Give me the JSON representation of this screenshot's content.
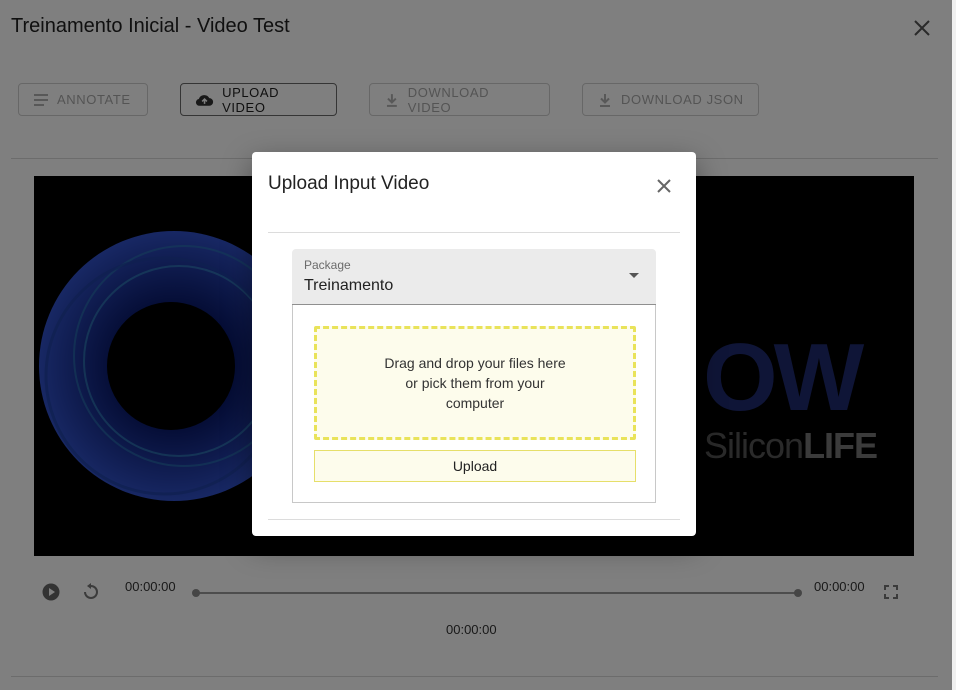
{
  "app": {
    "title": "Treinamento Inicial - Video Test"
  },
  "toolbar": {
    "annotate_label": "ANNOTATE",
    "upload_video_label": "UPLOAD VIDEO",
    "download_video_label": "DOWNLOAD VIDEO",
    "download_json_label": "DOWNLOAD JSON"
  },
  "video": {
    "brand_mark": "OW",
    "brand_name_light": "Silicon",
    "brand_name_bold": "LIFE"
  },
  "player": {
    "current_time": "00:00:00",
    "duration": "00:00:00",
    "time_display": "00:00:00",
    "progress": 0
  },
  "modal": {
    "title": "Upload Input Video",
    "package_label": "Package",
    "package_value": "Treinamento",
    "dropzone_text": "Drag and drop your files here or pick them from your computer",
    "upload_label": "Upload"
  },
  "colors": {
    "dropzone_border": "#e9e35a",
    "dropzone_bg": "#fdfcec",
    "overlay": "rgba(0,0,0,0.5)"
  }
}
